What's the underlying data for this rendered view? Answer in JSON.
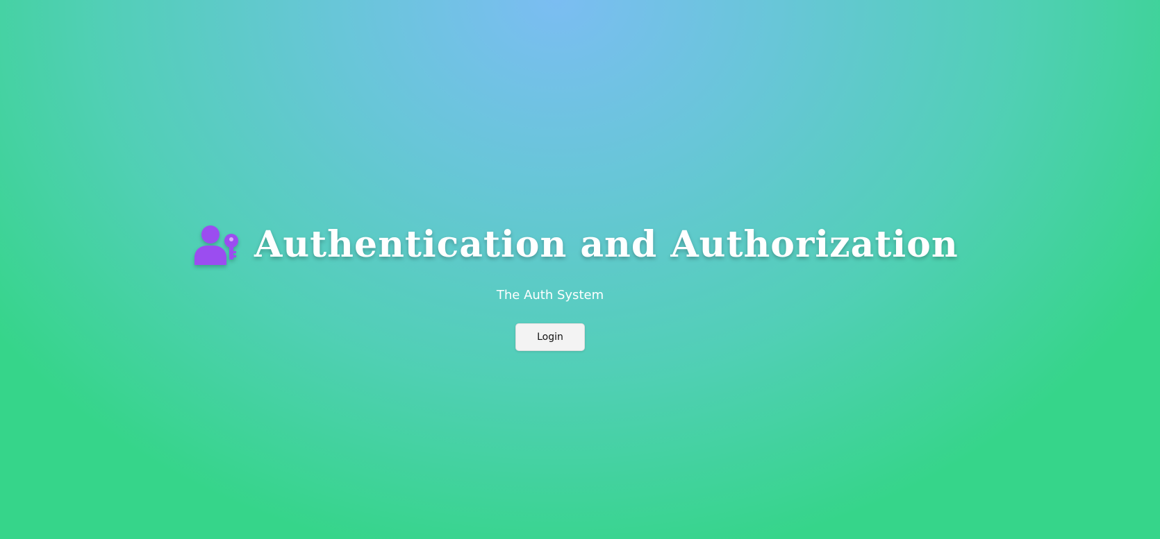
{
  "hero": {
    "logo_icon": "user-key-icon",
    "title": "Authentication and Authorization",
    "subtitle": "The Auth System",
    "login_label": "Login"
  },
  "colors": {
    "icon": "#9b4df0",
    "title_text": "#ffffff",
    "background_top": "#7bbdf2",
    "background_bottom": "#36d58a",
    "button_bg": "#f3f3f3"
  }
}
